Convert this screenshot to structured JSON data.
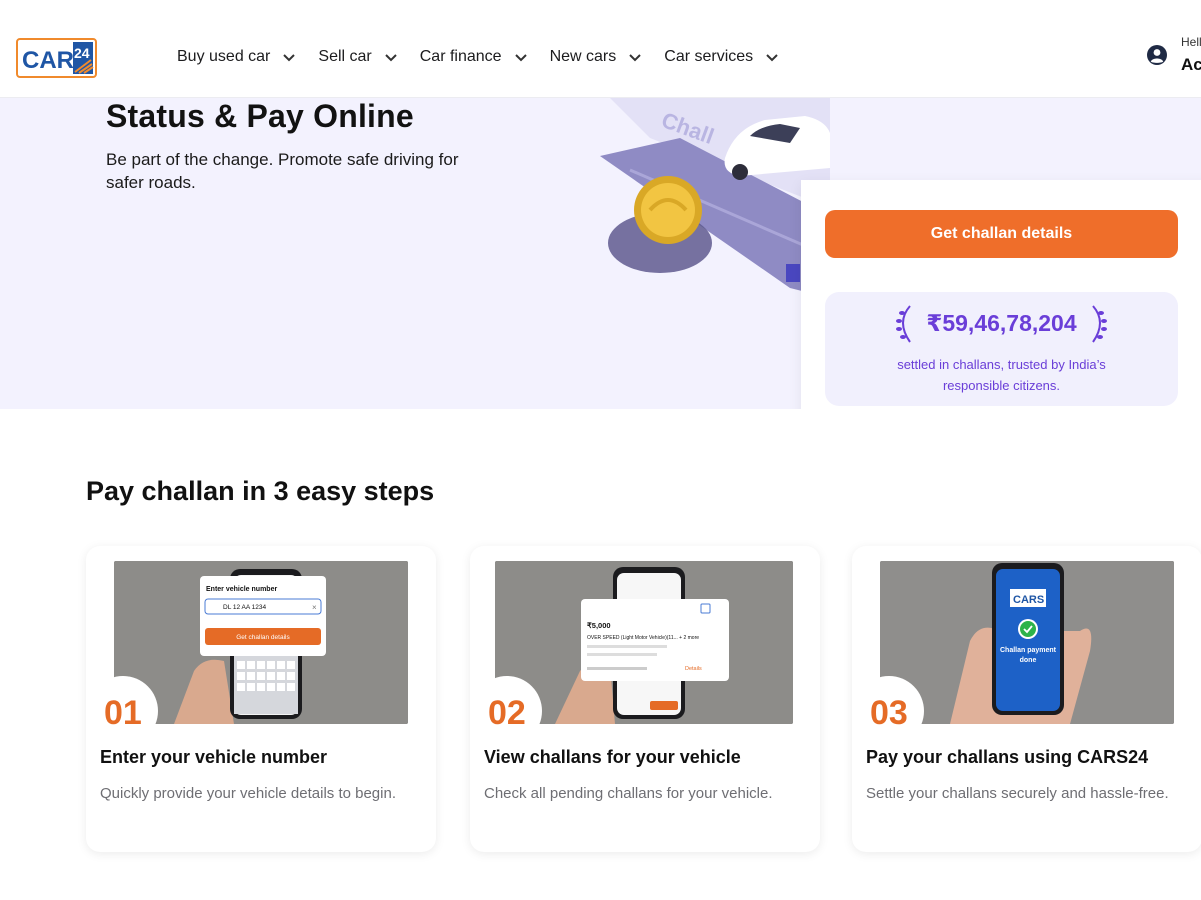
{
  "header": {
    "logo_text": "CARS",
    "logo_num": "24",
    "nav": [
      {
        "label": "Buy used car"
      },
      {
        "label": "Sell car"
      },
      {
        "label": "Car finance"
      },
      {
        "label": "New cars"
      },
      {
        "label": "Car services"
      }
    ],
    "account": {
      "hello": "Hell",
      "label": "Ac"
    }
  },
  "hero": {
    "title": "Status & Pay Online",
    "subtitle": "Be part of the change. Promote safe driving for safer roads.",
    "art_text": "Chall",
    "cta_label": "Get challan details",
    "stat_amount": "₹59,46,78,204",
    "stat_desc": "settled in challans, trusted by India’s responsible citizens."
  },
  "steps": {
    "title": "Pay challan in 3 easy steps",
    "items": [
      {
        "num": "01",
        "title": "Enter your vehicle number",
        "desc": "Quickly provide your vehicle details to begin.",
        "mock": {
          "label": "Enter vehicle number",
          "value": "DL 12 AA 1234",
          "button": "Get challan details"
        }
      },
      {
        "num": "02",
        "title": "View challans for your vehicle",
        "desc": "Check all pending challans for your vehicle.",
        "mock": {
          "amount": "₹5,000",
          "offence": "OVER SPEED (Light Motor Vehicle)(11... + 2 more",
          "link": "Details"
        }
      },
      {
        "num": "03",
        "title": "Pay your challans using CARS24",
        "desc": "Settle your challans securely and hassle-free.",
        "mock": {
          "status": "Challan payment done"
        }
      }
    ]
  },
  "colors": {
    "accent": "#ef6e2a",
    "purple": "#6a3ed8",
    "hero_bg": "#f3f2fe",
    "logo_blue": "#1f56a5"
  }
}
